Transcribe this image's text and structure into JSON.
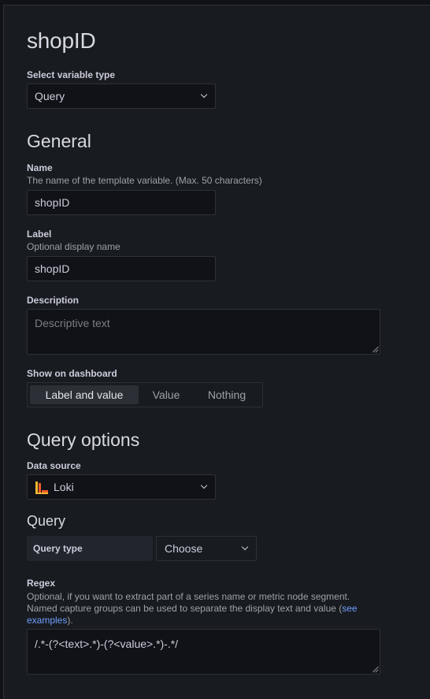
{
  "page": {
    "title": "shopID"
  },
  "variable_type": {
    "label": "Select variable type",
    "value": "Query"
  },
  "general": {
    "heading": "General",
    "name": {
      "label": "Name",
      "description": "The name of the template variable. (Max. 50 characters)",
      "value": "shopID"
    },
    "label_field": {
      "label": "Label",
      "description": "Optional display name",
      "value": "shopID"
    },
    "description_field": {
      "label": "Description",
      "placeholder": "Descriptive text"
    },
    "show_on_dashboard": {
      "label": "Show on dashboard",
      "options": [
        "Label and value",
        "Value",
        "Nothing"
      ],
      "selected": "Label and value"
    }
  },
  "query_options": {
    "heading": "Query options",
    "data_source": {
      "label": "Data source",
      "value": "Loki",
      "icon": "loki-logo-icon"
    },
    "query": {
      "heading": "Query",
      "query_type_label": "Query type",
      "query_type_value": "Choose"
    },
    "regex": {
      "label": "Regex",
      "description_line1": "Optional, if you want to extract part of a series name or metric node segment.",
      "description_line2": "Named capture groups can be used to separate the display text and value (",
      "link_part1": "see",
      "link_part2": "examples",
      "description_end": ").",
      "value": "/.*-(?<text>.*)-(?<value>.*)-.*/"
    }
  },
  "colors": {
    "background": "#111217",
    "panel": "#181b1f",
    "border": "#2d3036",
    "link": "#6e9fff",
    "text": "#ccccdc"
  }
}
